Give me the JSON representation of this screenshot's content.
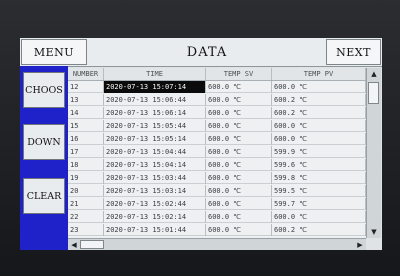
{
  "header": {
    "menu_label": "MENU",
    "title": "DATA",
    "next_label": "NEXT"
  },
  "sidebar": {
    "choose_label": "CHOOS",
    "down_label": "DOWN",
    "clear_label": "CLEAR"
  },
  "table": {
    "columns": [
      "NUMBER",
      "TIME",
      "TEMP SV",
      "TEMP PV"
    ],
    "rows": [
      {
        "number": "12",
        "time": "2020-07-13 15:07:14",
        "sv": "600.0 ℃",
        "pv": "600.0 ℃",
        "selected": true
      },
      {
        "number": "13",
        "time": "2020-07-13 15:06:44",
        "sv": "600.0 ℃",
        "pv": "600.2 ℃",
        "selected": false
      },
      {
        "number": "14",
        "time": "2020-07-13 15:06:14",
        "sv": "600.0 ℃",
        "pv": "600.2 ℃",
        "selected": false
      },
      {
        "number": "15",
        "time": "2020-07-13 15:05:44",
        "sv": "600.0 ℃",
        "pv": "600.0 ℃",
        "selected": false
      },
      {
        "number": "16",
        "time": "2020-07-13 15:05:14",
        "sv": "600.0 ℃",
        "pv": "600.0 ℃",
        "selected": false
      },
      {
        "number": "17",
        "time": "2020-07-13 15:04:44",
        "sv": "600.0 ℃",
        "pv": "599.9 ℃",
        "selected": false
      },
      {
        "number": "18",
        "time": "2020-07-13 15:04:14",
        "sv": "600.0 ℃",
        "pv": "599.6 ℃",
        "selected": false
      },
      {
        "number": "19",
        "time": "2020-07-13 15:03:44",
        "sv": "600.0 ℃",
        "pv": "599.8 ℃",
        "selected": false
      },
      {
        "number": "20",
        "time": "2020-07-13 15:03:14",
        "sv": "600.0 ℃",
        "pv": "599.5 ℃",
        "selected": false
      },
      {
        "number": "21",
        "time": "2020-07-13 15:02:44",
        "sv": "600.0 ℃",
        "pv": "599.7 ℃",
        "selected": false
      },
      {
        "number": "22",
        "time": "2020-07-13 15:02:14",
        "sv": "600.0 ℃",
        "pv": "600.0 ℃",
        "selected": false
      },
      {
        "number": "23",
        "time": "2020-07-13 15:01:44",
        "sv": "600.0 ℃",
        "pv": "600.2 ℃",
        "selected": false
      }
    ]
  },
  "icons": {
    "scroll_up": "up-arrow-icon",
    "scroll_down": "down-arrow-icon",
    "scroll_left": "left-arrow-icon",
    "scroll_right": "right-arrow-icon"
  },
  "colors": {
    "sidebar_blue": "#1e22c8",
    "selection_black": "#0b0b0b"
  }
}
